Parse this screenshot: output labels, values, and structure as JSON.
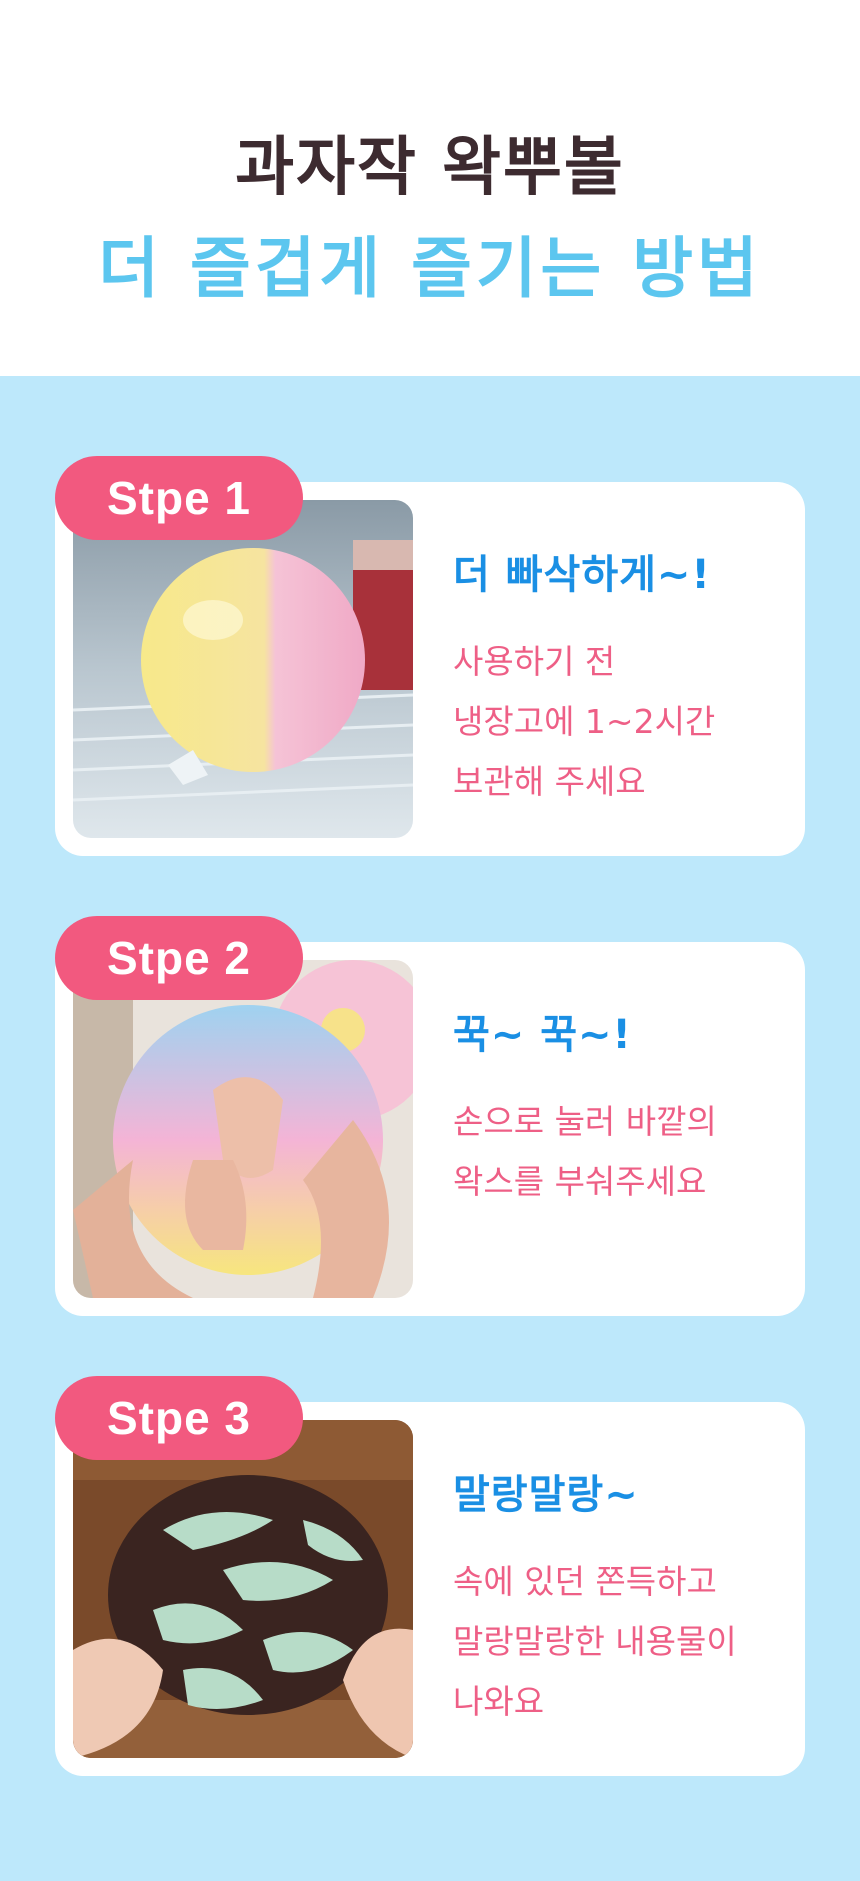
{
  "header": {
    "title_line1": "과자작 왁뿌볼",
    "title_line2": "더 즐겁게 즐기는 방법"
  },
  "steps": [
    {
      "badge": "Stpe 1",
      "heading": "더 빠삭하게~!",
      "lines": [
        "사용하기 전",
        "냉장고에 1~2시간",
        "보관해 주세요"
      ]
    },
    {
      "badge": "Stpe 2",
      "heading": "꾹~ 꾹~!",
      "lines": [
        "손으로 눌러 바깥의",
        "왁스를 부숴주세요"
      ]
    },
    {
      "badge": "Stpe 3",
      "heading": "말랑말랑~",
      "lines": [
        "속에 있던 쫀득하고",
        "말랑말랑한 내용물이",
        "나와요"
      ]
    }
  ],
  "colors": {
    "title_dark": "#3d2b30",
    "title_blue": "#5cc6ef",
    "background_blue": "#bde8fb",
    "badge_pink": "#f2597f",
    "heading_blue": "#1a8fe4",
    "desc_pink": "#ee5f86"
  }
}
